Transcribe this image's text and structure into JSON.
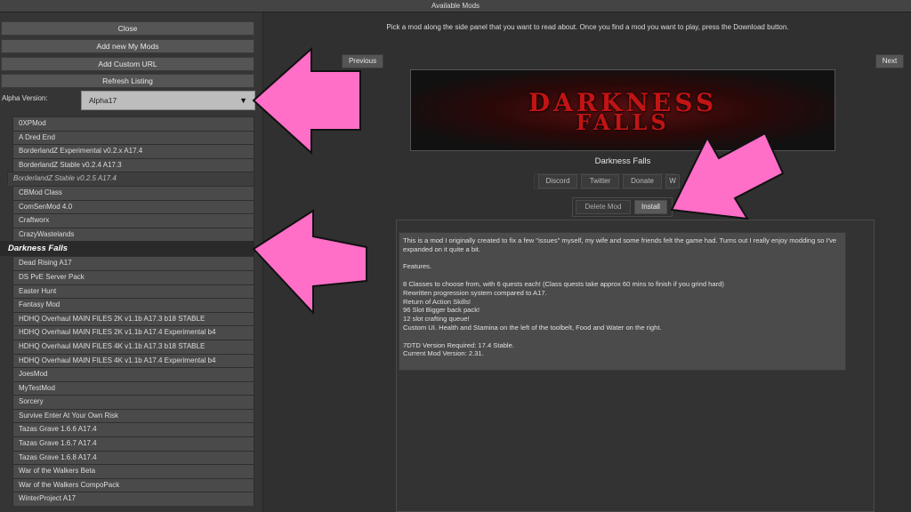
{
  "window": {
    "title": "Available Mods"
  },
  "sidebar": {
    "buttons": [
      {
        "label": "Close"
      },
      {
        "label": "Add new My Mods"
      },
      {
        "label": "Add Custom URL"
      },
      {
        "label": "Refresh Listing"
      }
    ],
    "alpha_label": "Alpha Version:",
    "alpha_value": "Alpha17",
    "dropdown_glyph": "▼"
  },
  "mods": [
    {
      "name": "0XPMod",
      "style": "normal"
    },
    {
      "name": "A Dred End",
      "style": "normal"
    },
    {
      "name": "BorderlandZ Experimental v0.2.x A17.4",
      "style": "normal"
    },
    {
      "name": "BorderlandZ Stable v0.2.4 A17.3",
      "style": "normal"
    },
    {
      "name": "BorderlandZ Stable v0.2.5 A17.4",
      "style": "italic"
    },
    {
      "name": "CBMod Class",
      "style": "normal"
    },
    {
      "name": "ComSenMod 4.0",
      "style": "normal"
    },
    {
      "name": "Craftworx",
      "style": "normal"
    },
    {
      "name": "CrazyWastelands",
      "style": "normal"
    },
    {
      "name": "Darkness Falls",
      "style": "selected"
    },
    {
      "name": "Dead Rising A17",
      "style": "normal"
    },
    {
      "name": "DS PvE Server Pack",
      "style": "normal"
    },
    {
      "name": "Easter Hunt",
      "style": "normal"
    },
    {
      "name": "Fantasy Mod",
      "style": "normal"
    },
    {
      "name": "HDHQ Overhaul MAIN FILES 2K v1.1b A17.3 b18 STABLE",
      "style": "normal"
    },
    {
      "name": "HDHQ Overhaul MAIN FILES 2K v1.1b A17.4 Experimental b4",
      "style": "normal"
    },
    {
      "name": "HDHQ Overhaul MAIN FILES 4K v1.1b A17.3 b18 STABLE",
      "style": "normal"
    },
    {
      "name": "HDHQ Overhaul MAIN FILES 4K v1.1b A17.4 Experimental b4",
      "style": "normal"
    },
    {
      "name": "JoesMod",
      "style": "normal"
    },
    {
      "name": "MyTestMod",
      "style": "normal"
    },
    {
      "name": "Sorcery",
      "style": "normal"
    },
    {
      "name": "Survive Enter At Your Own Risk",
      "style": "normal"
    },
    {
      "name": "Tazas Grave 1.6.6 A17.4",
      "style": "normal"
    },
    {
      "name": "Tazas Grave 1.6.7 A17.4",
      "style": "normal"
    },
    {
      "name": "Tazas Grave 1.6.8 A17.4",
      "style": "normal"
    },
    {
      "name": "War of the Walkers Beta",
      "style": "normal"
    },
    {
      "name": "War of the Walkers CompoPack",
      "style": "normal"
    },
    {
      "name": "WinterProject A17",
      "style": "normal"
    }
  ],
  "main": {
    "instructions": "Pick a mod along the side panel that you want to read about. Once you find a mod you want to play, press the Download button.",
    "previous_label": "Previous",
    "next_label": "Next",
    "banner_line1": "DARKNESS",
    "banner_line2": "FALLS",
    "mod_title": "Darkness Falls",
    "links": [
      {
        "label": "Discord"
      },
      {
        "label": "Twitter"
      },
      {
        "label": "Donate"
      },
      {
        "label": "W"
      }
    ],
    "delete_label": "Delete Mod",
    "install_label": "Install",
    "description": [
      "This is a mod I originally created to fix a few \"issues\" myself, my wife and some friends felt the game had. Turns out I really enjoy modding so I've expanded on it quite a bit.",
      "",
      "Features.",
      "",
      "8 Classes to choose from, with 6 quests each! (Class quests take approx 60 mins to finish if you grind hard)",
      "Rewritten progression system compared to A17.",
      "Return of Action Skills!",
      "96 Slot Bigger back pack!",
      "12 slot crafting queue!",
      "Custom UI. Health and Stamina on the left of the toolbelt, Food and Water on the right.",
      "",
      "7DTD Version Required: 17.4 Stable.",
      "Current Mod Version: 2.31."
    ]
  },
  "colors": {
    "arrow": "#ff6ec7",
    "arrow_outline": "#111111",
    "banner_text": "#c11414"
  }
}
